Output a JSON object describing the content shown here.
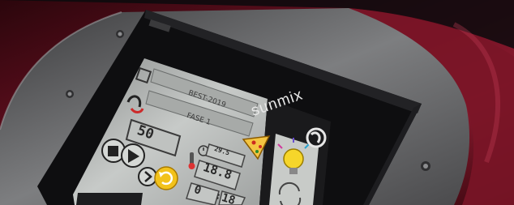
{
  "screen": {
    "program_label": "BEST-2019",
    "mode_label": "FASE 1",
    "speed_value": "50",
    "timer_value": "29.5",
    "temperature_value": "18.8",
    "time_minutes": "0",
    "time_seconds": "18"
  },
  "device": {
    "brand_name": "sunmix"
  },
  "colors": {
    "body": "#6a0f1f",
    "bezel": "#0f0f12",
    "lcd": "#b9bcb9",
    "accent_yellow": "#f2c21b"
  },
  "icons": [
    "recipe-icon",
    "mixer-hook-icon",
    "stop-icon",
    "play-icon",
    "next-icon",
    "refresh-icon",
    "thermometer-icon",
    "clock-icon",
    "pizza-icon",
    "light-bulb-icon",
    "recycle-icon",
    "brand-logo-icon",
    "screw-icon"
  ]
}
